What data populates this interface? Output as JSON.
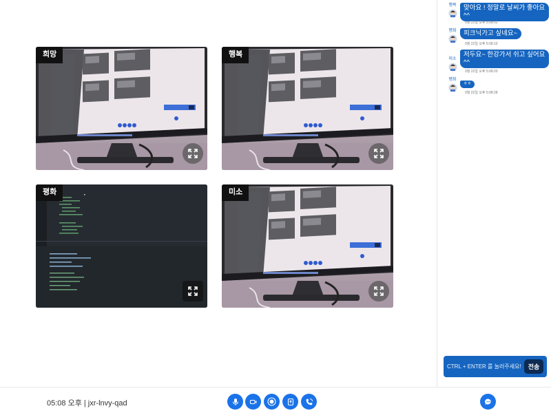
{
  "participants": [
    {
      "name": "희망",
      "feed": "monitor-camera"
    },
    {
      "name": "행복",
      "feed": "monitor-camera"
    },
    {
      "name": "평화",
      "feed": "code-editor-screen"
    },
    {
      "name": "미소",
      "feed": "monitor-camera"
    }
  ],
  "chat": {
    "messages": [
      {
        "sender": "행복",
        "text": "맞아요 ! 정말로 날씨가 좋아요",
        "text_line2": "^^",
        "time": "9월 22일 오후 5:08:02"
      },
      {
        "sender": "평화",
        "text": "피크닉가고 싶네요~",
        "time": "9월 22일 오후 5:08:10"
      },
      {
        "sender": "미소",
        "text": "저두요~ 한강가서 쉬고 싶어요",
        "text_line2": "^^",
        "time": "9월 22일 오후 5:08:20"
      },
      {
        "sender": "평화",
        "text": "ㅎㅎ",
        "time": "9월 22일 오후 5:08:28"
      }
    ],
    "input_placeholder": "CTRL + ENTER 를 눌러주세요!",
    "send_label": "전송"
  },
  "bottom_bar": {
    "meeting_info": "05:08 오후 | jxr-lnvy-qad",
    "controls": [
      "microphone-icon",
      "video-camera-icon",
      "record-icon",
      "screen-share-icon",
      "phone-icon"
    ],
    "chat_toggle_icon": "chat-bubble-icon"
  },
  "colors": {
    "accent": "#1a73e8",
    "chat_bubble": "#1565c0",
    "send_button": "#0d2a52",
    "name_tag": "#111111"
  }
}
